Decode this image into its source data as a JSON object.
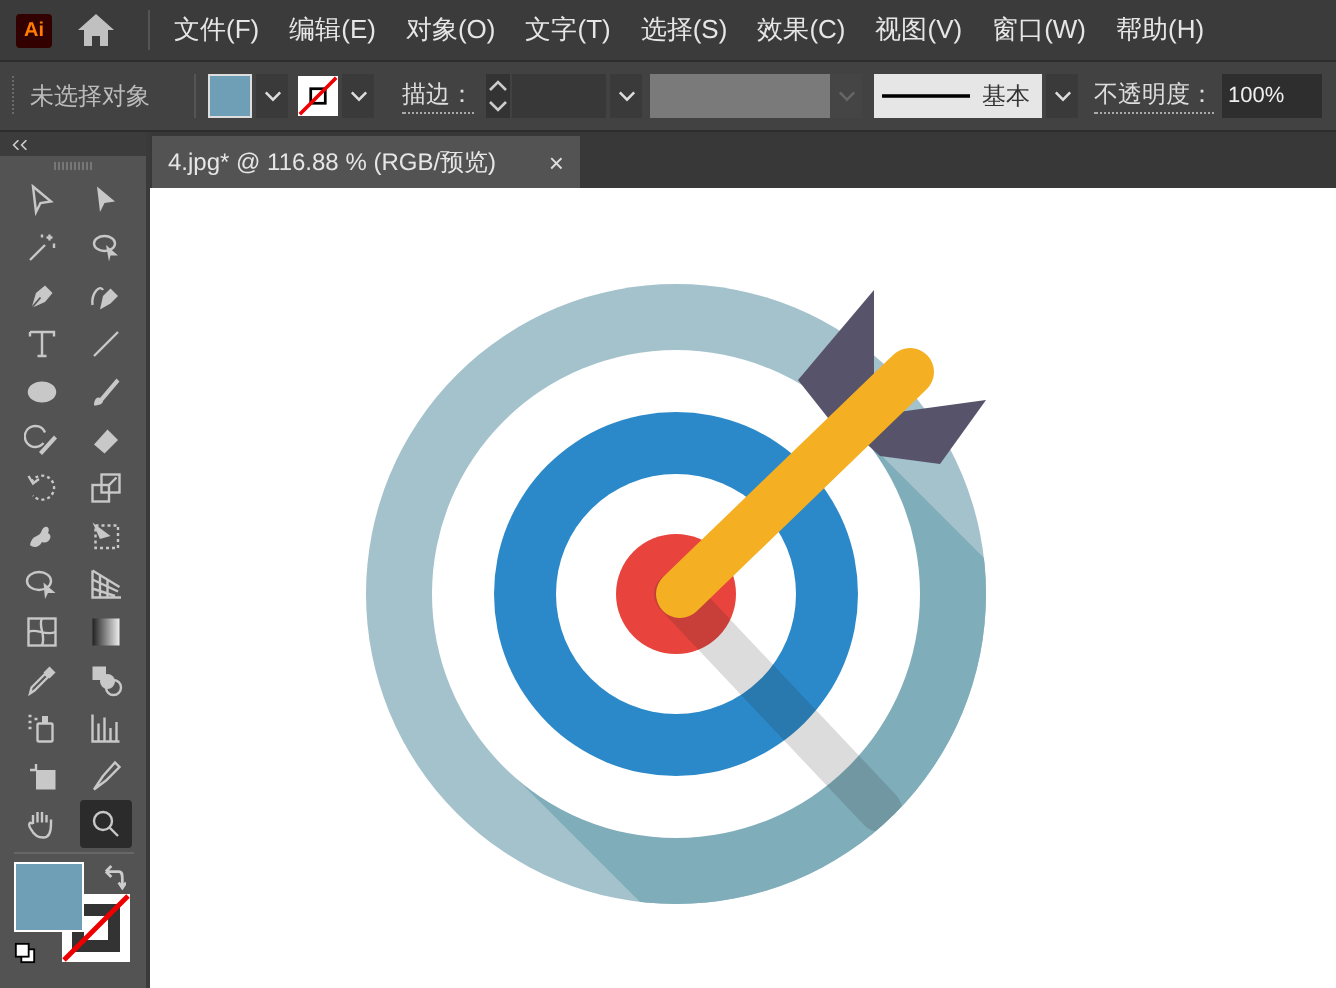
{
  "app": {
    "logo": "Ai"
  },
  "menu": [
    "文件(F)",
    "编辑(E)",
    "对象(O)",
    "文字(T)",
    "选择(S)",
    "效果(C)",
    "视图(V)",
    "窗口(W)",
    "帮助(H)"
  ],
  "control_bar": {
    "selection_status": "未选择对象",
    "stroke_label": "描边：",
    "brush": "基本",
    "opacity_label": "不透明度：",
    "opacity_value": "100%"
  },
  "document_tab": {
    "title": "4.jpg* @ 116.88 % (RGB/预览)",
    "close": "×"
  },
  "tools": [
    {
      "kind": "direct-select",
      "selected": false
    },
    {
      "kind": "select",
      "selected": false
    },
    {
      "kind": "wand",
      "selected": false
    },
    {
      "kind": "lasso",
      "selected": false
    },
    {
      "kind": "pen",
      "selected": false
    },
    {
      "kind": "curvature",
      "selected": false
    },
    {
      "kind": "type",
      "selected": false
    },
    {
      "kind": "line",
      "selected": false
    },
    {
      "kind": "ellipse",
      "selected": false
    },
    {
      "kind": "brush",
      "selected": false
    },
    {
      "kind": "shaper",
      "selected": false
    },
    {
      "kind": "eraser",
      "selected": false
    },
    {
      "kind": "rotate",
      "selected": false
    },
    {
      "kind": "scale",
      "selected": false
    },
    {
      "kind": "puppet",
      "selected": false
    },
    {
      "kind": "free-transform",
      "selected": false
    },
    {
      "kind": "shape-builder",
      "selected": false
    },
    {
      "kind": "perspective",
      "selected": false
    },
    {
      "kind": "mesh",
      "selected": false
    },
    {
      "kind": "gradient",
      "selected": false
    },
    {
      "kind": "eyedropper",
      "selected": false
    },
    {
      "kind": "blend",
      "selected": false
    },
    {
      "kind": "sprayer",
      "selected": false
    },
    {
      "kind": "graph",
      "selected": false
    },
    {
      "kind": "artboard",
      "selected": false
    },
    {
      "kind": "knife",
      "selected": false
    },
    {
      "kind": "hand",
      "selected": false
    },
    {
      "kind": "zoom",
      "selected": true
    }
  ]
}
